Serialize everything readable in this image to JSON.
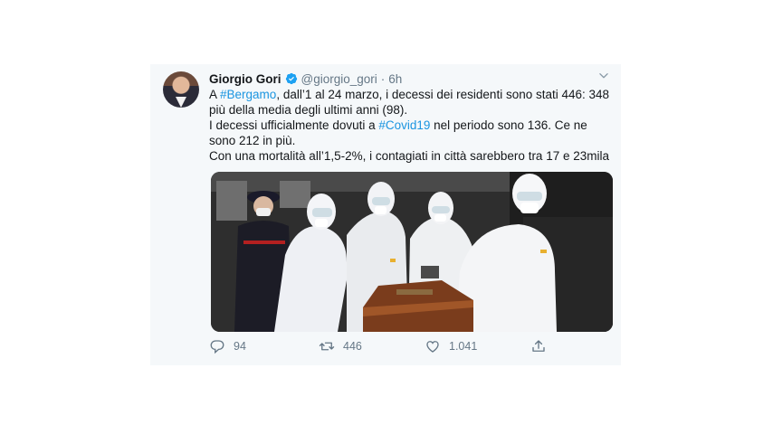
{
  "tweet": {
    "author_name": "Giorgio Gori",
    "handle": "@giorgio_gori",
    "separator": "·",
    "time": "6h",
    "lines": [
      {
        "pre": "A ",
        "tag": "#Bergamo",
        "post": ", dall’1 al 24 marzo, i decessi dei residenti sono stati 446: 348 più della media degli ultimi anni (98)."
      },
      {
        "pre": "I decessi ufficialmente dovuti a ",
        "tag": "#Covid19",
        "post": " nel periodo sono 136. Ce ne sono 212 in più."
      },
      {
        "pre": "Con una mortalità all’1,5-2%, i contagiati in città sarebbero tra 17 e 23mila",
        "tag": "",
        "post": ""
      }
    ],
    "counts": {
      "replies": "94",
      "retweets": "446",
      "likes": "1.041"
    },
    "colors": {
      "accent": "#1b95e0",
      "muted": "#657786",
      "text": "#14171a",
      "card_bg": "#f5f8fa"
    },
    "icons": [
      "verified-badge-icon",
      "chevron-down-icon",
      "reply-icon",
      "retweet-icon",
      "like-icon",
      "share-icon"
    ]
  }
}
